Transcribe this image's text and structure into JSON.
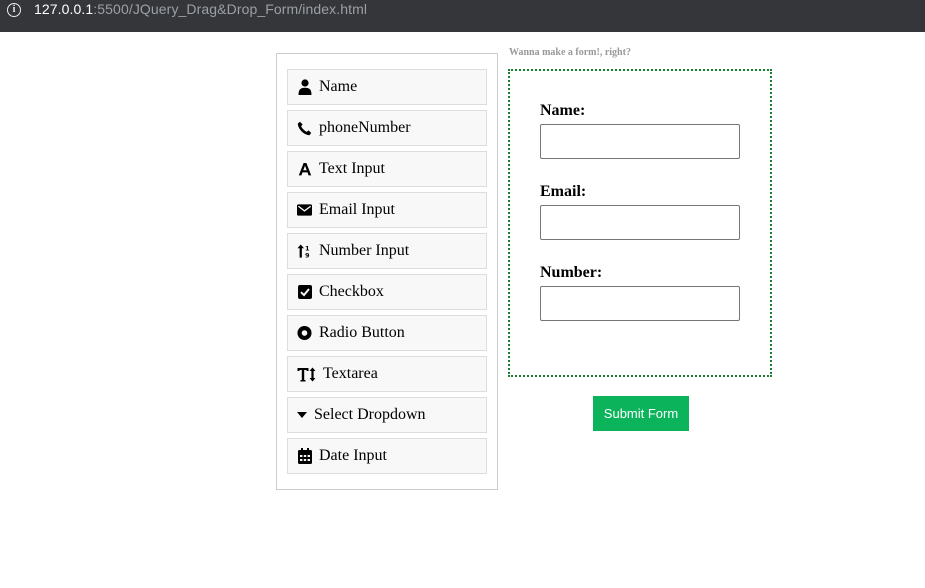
{
  "browser": {
    "url_host": "127.0.0.1",
    "url_path": ":5500/JQuery_Drag&Drop_Form/index.html"
  },
  "palette": {
    "items": [
      {
        "label": "Name",
        "icon": "user-icon"
      },
      {
        "label": "phoneNumber",
        "icon": "phone-icon"
      },
      {
        "label": "Text Input",
        "icon": "font-icon"
      },
      {
        "label": "Email Input",
        "icon": "envelope-icon"
      },
      {
        "label": "Number Input",
        "icon": "sort-numeric-icon"
      },
      {
        "label": "Checkbox",
        "icon": "check-square-icon"
      },
      {
        "label": "Radio Button",
        "icon": "dot-circle-icon"
      },
      {
        "label": "Textarea",
        "icon": "text-height-icon"
      },
      {
        "label": "Select Dropdown",
        "icon": "caret-down-icon"
      },
      {
        "label": "Date Input",
        "icon": "calendar-icon"
      }
    ]
  },
  "form": {
    "heading": "Wanna make a form!, right?",
    "fields": [
      {
        "label": "Name:",
        "value": ""
      },
      {
        "label": "Email:",
        "value": ""
      },
      {
        "label": "Number:",
        "value": ""
      }
    ],
    "submit_label": "Submit Form"
  },
  "colors": {
    "dropzone_border": "#1a7f2e",
    "submit_bg": "#0bb35b",
    "browser_bar": "#35363a"
  }
}
